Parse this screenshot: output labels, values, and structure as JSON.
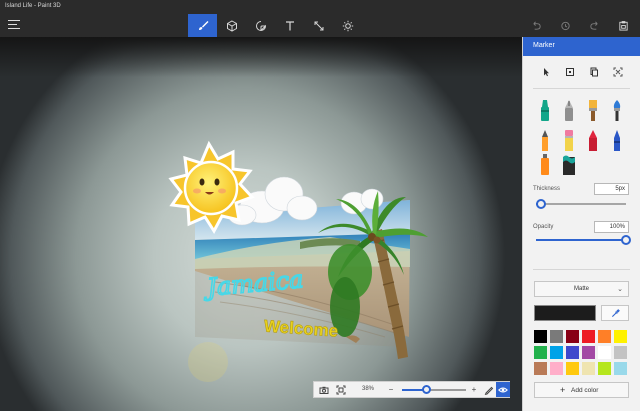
{
  "window": {
    "title": "Island Life - Paint 3D"
  },
  "toolbar": {
    "menu_icon": "hamburger-icon",
    "tools": [
      {
        "name": "brushes",
        "icon": "brush-icon",
        "active": true
      },
      {
        "name": "3d-shapes",
        "icon": "cube-icon",
        "active": false
      },
      {
        "name": "stickers",
        "icon": "sticker-icon",
        "active": false
      },
      {
        "name": "text",
        "icon": "text-icon",
        "active": false
      },
      {
        "name": "canvas",
        "icon": "canvas-icon",
        "active": false
      },
      {
        "name": "effects",
        "icon": "sun-icon",
        "active": false
      }
    ],
    "right_tools": [
      "undo-icon",
      "history-icon",
      "redo-icon",
      "paste-icon"
    ]
  },
  "canvas": {
    "artwork": {
      "signature_text": "Jamaica",
      "welcome_text": "Welcome"
    }
  },
  "zoombar": {
    "zoom_label": "38%",
    "zoom_level": 0.38,
    "minus": "−",
    "plus": "+",
    "icons": [
      "camera-icon",
      "fit-icon",
      "minus-icon",
      "plus-icon",
      "pen-icon",
      "eye-icon"
    ]
  },
  "panel": {
    "title": "Marker",
    "modes": [
      "select-icon",
      "sticker-mode-icon",
      "copy-icon",
      "crop-icon"
    ],
    "brushes": [
      {
        "name": "marker",
        "color": "#13a68a"
      },
      {
        "name": "calligraphy-pen",
        "color": "#8f8f8f"
      },
      {
        "name": "oil-brush",
        "color": "#f2b43a"
      },
      {
        "name": "watercolor",
        "color": "#2f7bd6"
      },
      {
        "name": "pixel-pen",
        "color": "#ff9e2a"
      },
      {
        "name": "pencil",
        "color": "#f07aa0"
      },
      {
        "name": "eraser",
        "color": "#e0243d"
      },
      {
        "name": "crayon",
        "color": "#2a57c7"
      },
      {
        "name": "spray-can",
        "color": "#ff8a1a"
      },
      {
        "name": "fill",
        "color": "#1aa59b"
      }
    ],
    "thickness": {
      "label": "Thickness",
      "value": "5px",
      "level": 0.05
    },
    "opacity": {
      "label": "Opacity",
      "value": "100%",
      "level": 1.0
    },
    "finish": {
      "value": "Matte"
    },
    "current_color": "#1c1c1c",
    "palette": [
      "#000000",
      "#7a7a7a",
      "#880015",
      "#ed1c24",
      "#ff7f27",
      "#fff200",
      "#22b14c",
      "#00a2e8",
      "#3f48cc",
      "#a349a4",
      "#ffffff",
      "#c3c3c3",
      "#b97a57",
      "#ffaec9",
      "#ffc90e",
      "#efe4b0",
      "#b5e61d",
      "#99d9ea"
    ],
    "add_color": {
      "label": "Add color",
      "icon": "plus-icon"
    }
  }
}
